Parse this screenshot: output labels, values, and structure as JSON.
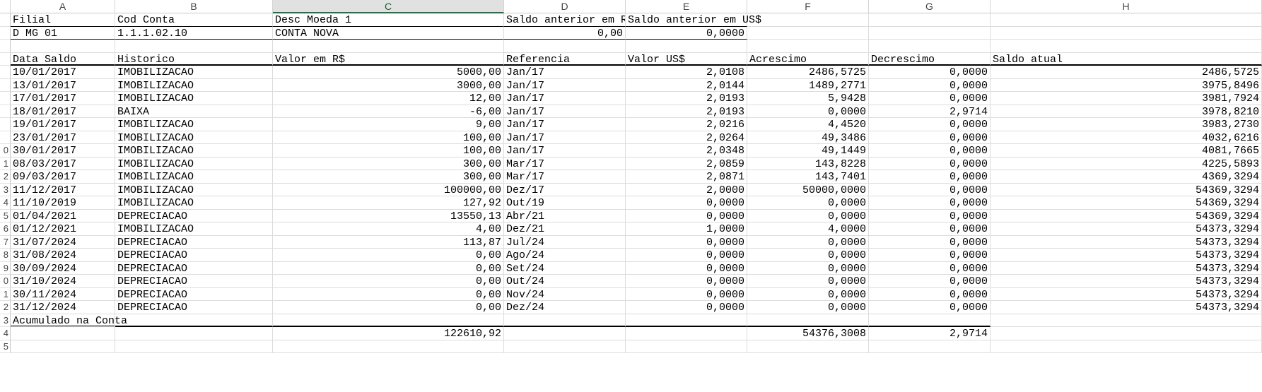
{
  "spreadsheet": {
    "selected_column": "C",
    "columns": [
      "A",
      "B",
      "C",
      "D",
      "E",
      "F",
      "G",
      "H"
    ],
    "row_numbers": [
      "",
      "",
      "",
      "",
      "",
      "",
      "",
      "",
      "",
      "",
      "0",
      "1",
      "2",
      "3",
      "4",
      "5",
      "6",
      "7",
      "8",
      "9",
      "0",
      "1",
      "2",
      "3",
      "4",
      "5"
    ],
    "header_row": [
      "Filial",
      "Cod Conta",
      "Desc Moeda 1",
      "Saldo anterior em R",
      "Saldo anterior em US$"
    ],
    "info_row": [
      "D MG 01",
      "1.1.1.02.10",
      "CONTA NOVA",
      "0,00",
      "0,0000"
    ],
    "table_headers": [
      "Data Saldo",
      "Historico",
      "Valor em R$",
      "Referencia",
      "Valor US$",
      "Acrescimo",
      "Decrescimo",
      "Saldo atual"
    ],
    "rows": [
      [
        "10/01/2017",
        "IMOBILIZACAO",
        "5000,00",
        "Jan/17",
        "2,0108",
        "2486,5725",
        "0,0000",
        "2486,5725"
      ],
      [
        "13/01/2017",
        "IMOBILIZACAO",
        "3000,00",
        "Jan/17",
        "2,0144",
        "1489,2771",
        "0,0000",
        "3975,8496"
      ],
      [
        "17/01/2017",
        "IMOBILIZACAO",
        "12,00",
        "Jan/17",
        "2,0193",
        "5,9428",
        "0,0000",
        "3981,7924"
      ],
      [
        "18/01/2017",
        "BAIXA",
        "-6,00",
        "Jan/17",
        "2,0193",
        "0,0000",
        "2,9714",
        "3978,8210"
      ],
      [
        "19/01/2017",
        "IMOBILIZACAO",
        "9,00",
        "Jan/17",
        "2,0216",
        "4,4520",
        "0,0000",
        "3983,2730"
      ],
      [
        "23/01/2017",
        "IMOBILIZACAO",
        "100,00",
        "Jan/17",
        "2,0264",
        "49,3486",
        "0,0000",
        "4032,6216"
      ],
      [
        "30/01/2017",
        "IMOBILIZACAO",
        "100,00",
        "Jan/17",
        "2,0348",
        "49,1449",
        "0,0000",
        "4081,7665"
      ],
      [
        "08/03/2017",
        "IMOBILIZACAO",
        "300,00",
        "Mar/17",
        "2,0859",
        "143,8228",
        "0,0000",
        "4225,5893"
      ],
      [
        "09/03/2017",
        "IMOBILIZACAO",
        "300,00",
        "Mar/17",
        "2,0871",
        "143,7401",
        "0,0000",
        "4369,3294"
      ],
      [
        "11/12/2017",
        "IMOBILIZACAO",
        "100000,00",
        "Dez/17",
        "2,0000",
        "50000,0000",
        "0,0000",
        "54369,3294"
      ],
      [
        "11/10/2019",
        "IMOBILIZACAO",
        "127,92",
        "Out/19",
        "0,0000",
        "0,0000",
        "0,0000",
        "54369,3294"
      ],
      [
        "01/04/2021",
        "DEPRECIACAO",
        "13550,13",
        "Abr/21",
        "0,0000",
        "0,0000",
        "0,0000",
        "54369,3294"
      ],
      [
        "01/12/2021",
        "IMOBILIZACAO",
        "4,00",
        "Dez/21",
        "1,0000",
        "4,0000",
        "0,0000",
        "54373,3294"
      ],
      [
        "31/07/2024",
        "DEPRECIACAO",
        "113,87",
        "Jul/24",
        "0,0000",
        "0,0000",
        "0,0000",
        "54373,3294"
      ],
      [
        "31/08/2024",
        "DEPRECIACAO",
        "0,00",
        "Ago/24",
        "0,0000",
        "0,0000",
        "0,0000",
        "54373,3294"
      ],
      [
        "30/09/2024",
        "DEPRECIACAO",
        "0,00",
        "Set/24",
        "0,0000",
        "0,0000",
        "0,0000",
        "54373,3294"
      ],
      [
        "31/10/2024",
        "DEPRECIACAO",
        "0,00",
        "Out/24",
        "0,0000",
        "0,0000",
        "0,0000",
        "54373,3294"
      ],
      [
        "30/11/2024",
        "DEPRECIACAO",
        "0,00",
        "Nov/24",
        "0,0000",
        "0,0000",
        "0,0000",
        "54373,3294"
      ],
      [
        "31/12/2024",
        "DEPRECIACAO",
        "0,00",
        "Dez/24",
        "0,0000",
        "0,0000",
        "0,0000",
        "54373,3294"
      ]
    ],
    "accumulated_label": "Acumulado na Conta",
    "totals": {
      "valor_reais": "122610,92",
      "acrescimo": "54376,3008",
      "decrescimo": "2,9714"
    }
  }
}
